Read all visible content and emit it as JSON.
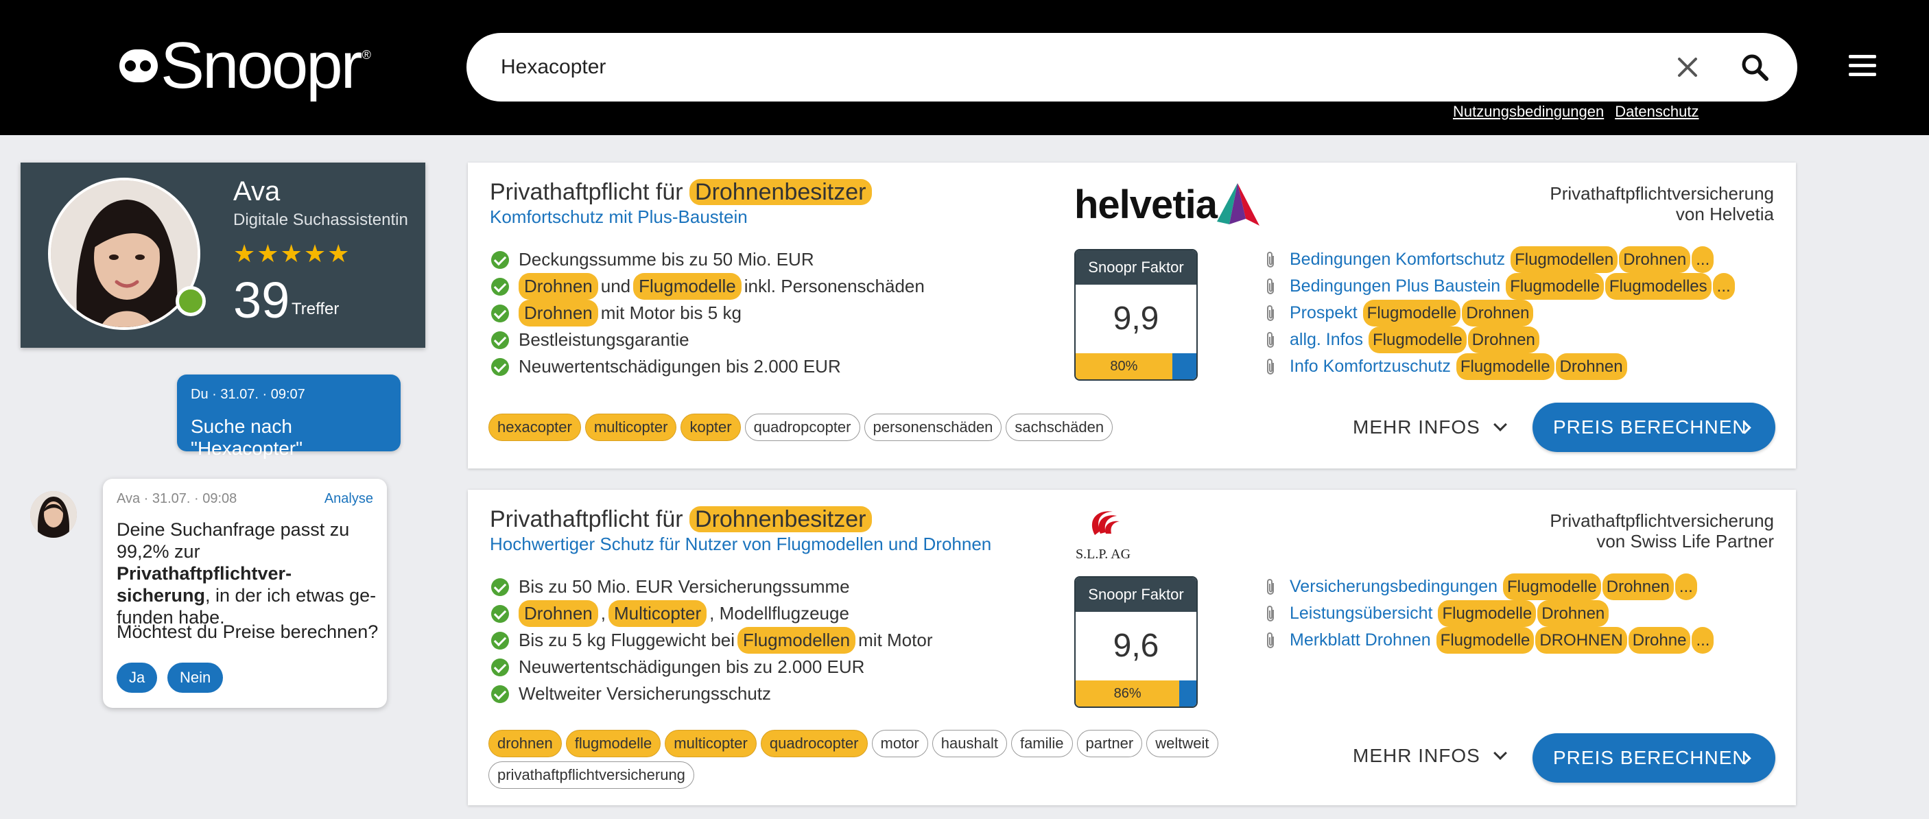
{
  "header": {
    "logo": "Snoopr",
    "logo_mark": "®",
    "search_value": "Hexacopter",
    "links": [
      "Nutzungsbedingungen",
      "Datenschutz"
    ]
  },
  "assistant": {
    "name": "Ava",
    "role": "Digitale Suchassistentin",
    "stars": "★★★★★",
    "rating": 5,
    "hits": "39",
    "hits_label": "Treffer"
  },
  "chat": {
    "user_meta": "Du · 31.07. · 09:07",
    "user_msg": "Suche nach \"Hexacopter\"",
    "bot_meta": "Ava · 31.07. · 09:08",
    "bot_link": "Analyse",
    "bot_msg_1": "Deine Suchanfrage passt zu 99,2% zur ",
    "bot_msg_bold": "Privathaftpflichtver­sicherung",
    "bot_msg_2": ", in der ich etwas ge­funden habe.",
    "bot_question": "Möchtest du Preise berechnen?",
    "yes": "Ja",
    "no": "Nein"
  },
  "results": [
    {
      "title_pre": "Privathaftpflicht für",
      "title_hl": "Drohnenbesitzer",
      "subtitle": "Komfortschutz mit Plus-Baustein",
      "insurer_1": "Privathaftpflichtversicherung",
      "insurer_2": "von Helvetia",
      "brand": "helvetia",
      "f1": "Deckungssumme bis zu 50 Mio. EUR",
      "f2a": "Drohnen",
      "f2b": "und",
      "f2c": "Flugmodelle",
      "f2d": "inkl. Personenschäden",
      "f3a": "Drohnen",
      "f3b": "mit Motor bis 5 kg",
      "f4": "Bestleistungsgarantie",
      "f5": "Neuwertentschädigungen bis 2.000 EUR",
      "factor_label": "Snoopr Faktor",
      "factor": "9,9",
      "percent": "80%",
      "percent_value": 80,
      "docs": [
        {
          "label": "Bedingungen Komfortschutz",
          "tags": [
            "Flugmodellen",
            "Drohnen",
            "..."
          ]
        },
        {
          "label": "Bedingungen Plus Baustein",
          "tags": [
            "Flugmodelle",
            "Flugmodelles",
            "..."
          ]
        },
        {
          "label": "Prospekt",
          "tags": [
            "Flugmodelle",
            "Drohnen"
          ]
        },
        {
          "label": "allg. Infos",
          "tags": [
            "Flugmodelle",
            "Drohnen"
          ]
        },
        {
          "label": "Info Komfortzuschutz",
          "tags": [
            "Flugmodelle",
            "Drohnen"
          ]
        }
      ],
      "tags": [
        "hexacopter",
        "multicopter",
        "kopter",
        "quadropcopter",
        "personenschäden",
        "sachschäden"
      ],
      "mehr": "MEHR INFOS",
      "preis": "PREIS BERECHNEN"
    },
    {
      "title_pre": "Privathaftpflicht für",
      "title_hl": "Drohnenbesitzer",
      "subtitle": "Hochwertiger Schutz für Nutzer von Flugmodellen und Drohnen",
      "insurer_1": "Privathaftpflichtversicherung",
      "insurer_2": "von Swiss Life Partner",
      "brand": "S.L.P. AG",
      "f1": "Bis zu 50 Mio. EUR Versicherungssumme",
      "f2a": "Drohnen",
      "f2b": "Multicopter",
      "f2c": ", Modellflugzeuge",
      "f3a": "Bis zu 5 kg Fluggewicht bei",
      "f3b": "Flugmodellen",
      "f3c": "mit Motor",
      "f4": "Neuwertentschädigungen bis zu 2.000 EUR",
      "f5": "Weltweiter Versicherungsschutz",
      "factor_label": "Snoopr Faktor",
      "factor": "9,6",
      "percent": "86%",
      "percent_value": 86,
      "docs": [
        {
          "label": "Versicherungsbedingungen",
          "tags": [
            "Flugmodelle",
            "Drohnen",
            "..."
          ]
        },
        {
          "label": "Leistungsübersicht",
          "tags": [
            "Flugmodelle",
            "Drohnen"
          ]
        },
        {
          "label": "Merkblatt Drohnen",
          "tags": [
            "Flugmodelle",
            "DROHNEN",
            "Drohne",
            "..."
          ]
        }
      ],
      "tags": [
        "drohnen",
        "flugmodelle",
        "multicopter",
        "quadrocopter",
        "motor",
        "haushalt",
        "familie",
        "partner",
        "weltweit",
        "privathaftpflichtversicherung"
      ],
      "mehr": "MEHR INFOS",
      "preis": "PREIS BERECHNEN"
    }
  ],
  "colors": {
    "accent": "#1a73bd",
    "highlight": "#f6b929",
    "check": "#4fa434",
    "panel": "#374750"
  }
}
